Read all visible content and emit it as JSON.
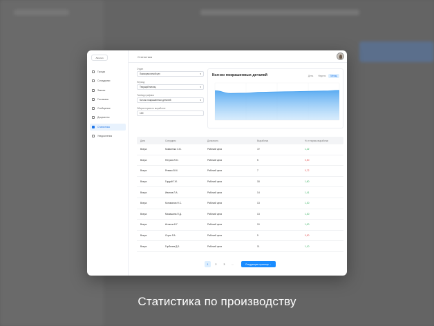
{
  "app": {
    "logo": "Логотип",
    "page_title": "Статистика"
  },
  "sidebar": {
    "items": [
      {
        "label": "Города",
        "icon": "building-icon",
        "active": false
      },
      {
        "label": "Сотрудники",
        "icon": "users-icon",
        "active": false
      },
      {
        "label": "Заказы",
        "icon": "orders-icon",
        "active": false
      },
      {
        "label": "Госзаказы",
        "icon": "gov-orders-icon",
        "active": false
      },
      {
        "label": "Сообщения",
        "icon": "mail-icon",
        "active": false
      },
      {
        "label": "Документы",
        "icon": "document-icon",
        "active": false
      },
      {
        "label": "Статистика",
        "icon": "stats-icon",
        "active": true
      },
      {
        "label": "Уведомления",
        "icon": "bell-icon",
        "active": false
      }
    ]
  },
  "filters": {
    "workshop_label": "Отдел",
    "workshop_value": "Лакокрасочный цех",
    "period_label": "Период",
    "period_value": "Текущий месяц",
    "chart_type_label": "Тип/вид графика",
    "chart_type_value": "Кол-во покрашенных деталей",
    "norm_label": "Общая норма по выработке",
    "norm_value": "100"
  },
  "chart": {
    "title": "Кол-во покрашенных деталей",
    "ranges": [
      "День",
      "Неделя",
      "Месяц"
    ],
    "active_range": "Месяц",
    "accent": "#4aa3f0"
  },
  "chart_data": {
    "type": "area",
    "title": "Кол-во покрашенных деталей",
    "y": [
      95,
      86,
      87,
      90,
      91,
      92,
      93,
      94,
      96
    ],
    "ylim": [
      0,
      120
    ],
    "grid": true
  },
  "table": {
    "headers": [
      "Дата",
      "Сотрудник",
      "Должность",
      "Выработка",
      "% от нормы выработки"
    ],
    "rows": [
      [
        "Вчера",
        "Коваленко С.В.",
        "Рабочий цеха",
        "72",
        "1,22",
        "pos"
      ],
      [
        "Вчера",
        "Петров И.Ю.",
        "Рабочий цеха",
        "5",
        "0,50",
        "neg"
      ],
      [
        "Вчера",
        "Ревяко В.М.",
        "Рабочий цеха",
        "7",
        "0,72",
        "neg"
      ],
      [
        "Вчера",
        "Гордий Г.М.",
        "Рабочий цеха",
        "18",
        "1,60",
        "pos"
      ],
      [
        "Вчера",
        "Иванов Л.А.",
        "Рабочий цеха",
        "14",
        "1,41",
        "pos"
      ],
      [
        "Вчера",
        "Коновалов Н.С.",
        "Рабочий цеха",
        "13",
        "1,30",
        "pos"
      ],
      [
        "Вчера",
        "Малашина П.Д.",
        "Рабочий цеха",
        "13",
        "1,30",
        "pos"
      ],
      [
        "Вчера",
        "Игнатов Б.Г.",
        "Рабочий цеха",
        "10",
        "1,00",
        "pos"
      ],
      [
        "Вчера",
        "Огуль Р.А.",
        "Рабочий цеха",
        "9",
        "0,90",
        "neg"
      ],
      [
        "Вчера",
        "Горбачев Д.Б.",
        "Рабочий цеха",
        "11",
        "1,10",
        "pos"
      ]
    ]
  },
  "pagination": {
    "pages": [
      "1",
      "2",
      "3",
      "..."
    ],
    "active_page": "1",
    "next_label": "Следующая страница →"
  },
  "caption": "Статистика по производству"
}
